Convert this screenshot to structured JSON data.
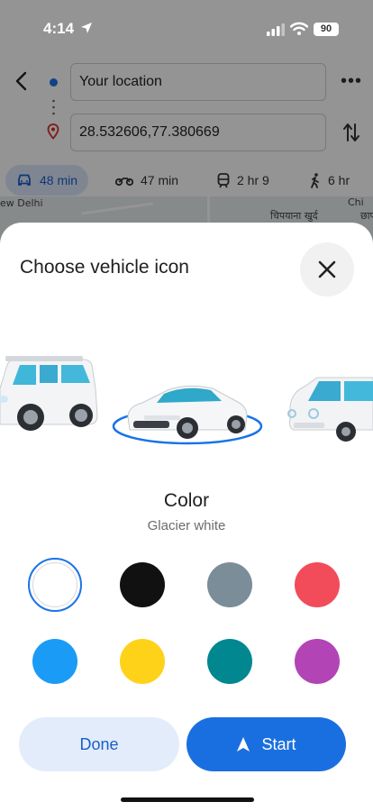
{
  "status_bar": {
    "time": "4:14",
    "battery": "90"
  },
  "directions": {
    "origin": "Your location",
    "destination": "28.532606,77.380669",
    "modes": [
      {
        "icon": "car-icon",
        "label": "48 min",
        "selected": true
      },
      {
        "icon": "motorcycle-icon",
        "label": "47 min",
        "selected": false
      },
      {
        "icon": "train-icon",
        "label": "2 hr 9",
        "selected": false
      },
      {
        "icon": "walk-icon",
        "label": "6 hr",
        "selected": false
      }
    ]
  },
  "map": {
    "label_left": "ew Delhi",
    "label_mid_1": "चिपयाना खुर्द",
    "label_right_1": "Chi",
    "label_right_2": "छाप"
  },
  "sheet": {
    "title": "Choose vehicle icon",
    "vehicles": [
      "suv-icon",
      "sports-car-icon",
      "compact-car-icon"
    ],
    "selected_vehicle": "sports-car-icon",
    "color_title": "Color",
    "selected_color_name": "Glacier white",
    "colors": [
      "#ffffff",
      "#111111",
      "#7a8d99",
      "#f24b5a",
      "#1a9bf5",
      "#ffd21a",
      "#008790",
      "#b244b6"
    ],
    "done_label": "Done",
    "start_label": "Start"
  },
  "accent": "#1a73e8"
}
